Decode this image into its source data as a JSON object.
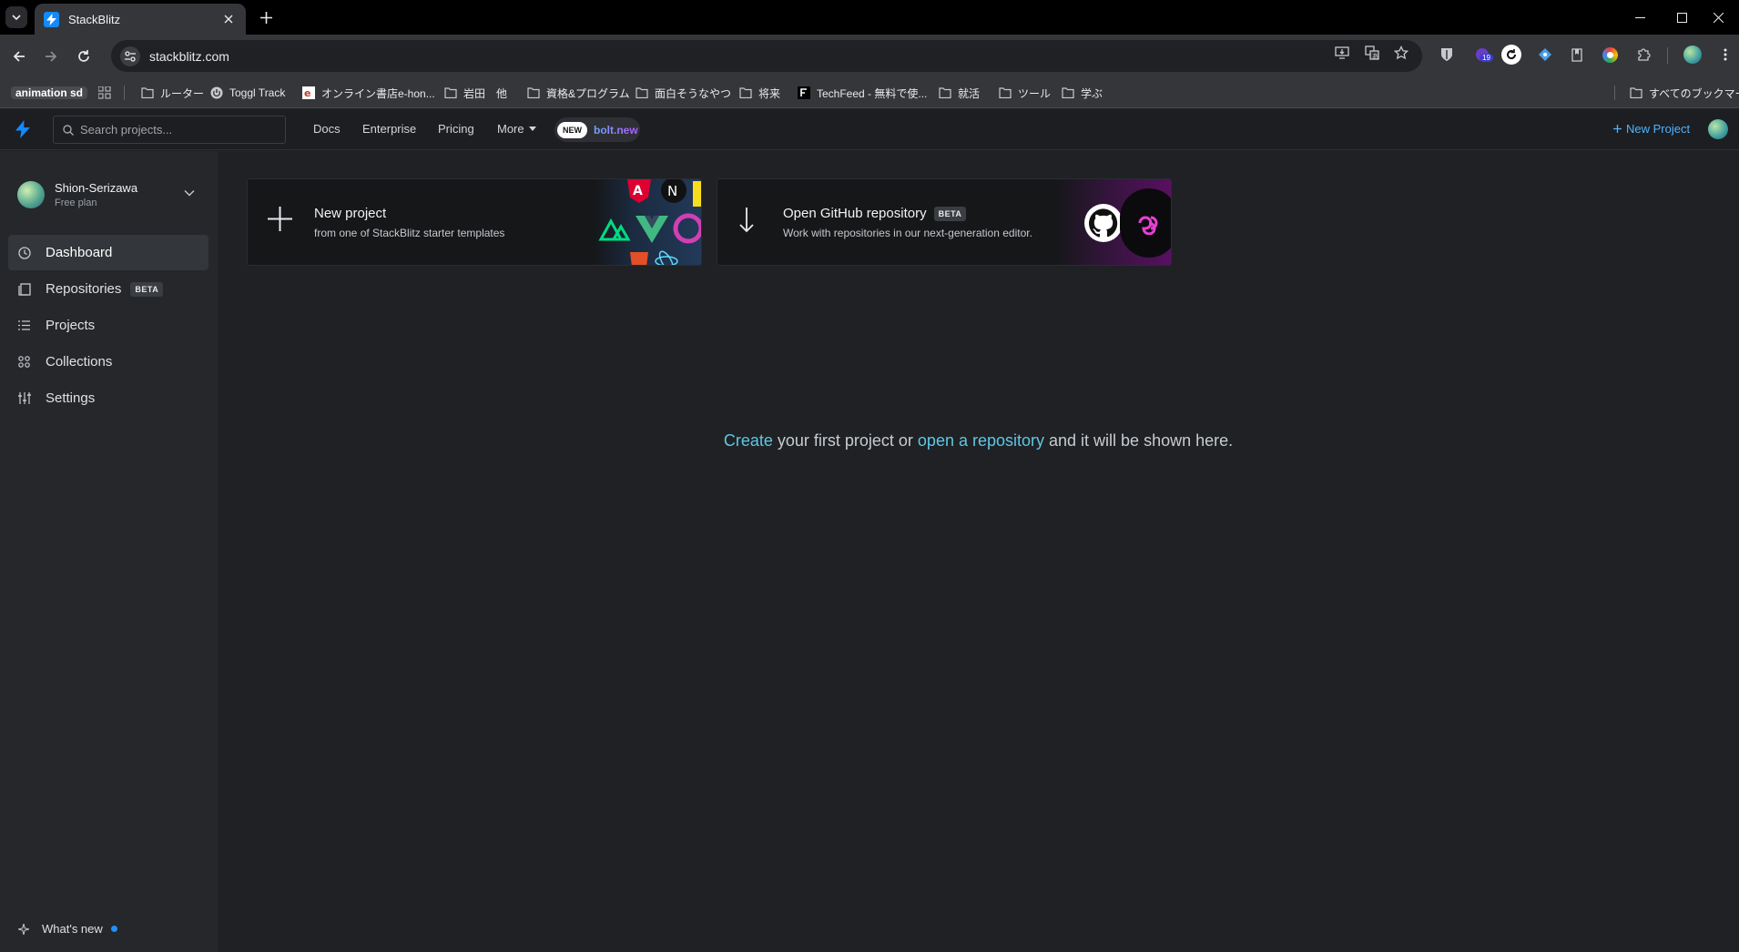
{
  "browser": {
    "tab_title": "StackBlitz",
    "url": "stackblitz.com",
    "extension_badge": "19",
    "bookmarks": [
      {
        "label": "animation sd",
        "type": "pill"
      },
      {
        "label": "",
        "type": "apps-icon"
      },
      {
        "label": "ルーター",
        "type": "folder"
      },
      {
        "label": "Toggl Track",
        "type": "site"
      },
      {
        "label": "オンライン書店e-hon...",
        "type": "site"
      },
      {
        "label": "岩田　他",
        "type": "folder"
      },
      {
        "label": "資格&プログラム",
        "type": "folder"
      },
      {
        "label": "面白そうなやつ",
        "type": "folder"
      },
      {
        "label": "将来",
        "type": "folder"
      },
      {
        "label": "TechFeed - 無料で使...",
        "type": "site"
      },
      {
        "label": "就活",
        "type": "folder"
      },
      {
        "label": "ツール",
        "type": "folder"
      },
      {
        "label": "学ぶ",
        "type": "folder"
      }
    ],
    "all_bookmarks": "すべてのブックマーク"
  },
  "header": {
    "search_placeholder": "Search projects...",
    "nav": [
      "Docs",
      "Enterprise",
      "Pricing",
      "More"
    ],
    "new_badge": "NEW",
    "bolt_label": "bolt.new",
    "new_project": "New Project"
  },
  "sidebar": {
    "user_name": "Shion-Serizawa",
    "plan": "Free plan",
    "items": [
      {
        "label": "Dashboard",
        "icon": "clock-icon",
        "active": true
      },
      {
        "label": "Repositories",
        "icon": "repo-icon",
        "badge": "BETA"
      },
      {
        "label": "Projects",
        "icon": "list-icon"
      },
      {
        "label": "Collections",
        "icon": "grid-icon"
      },
      {
        "label": "Settings",
        "icon": "sliders-icon"
      }
    ],
    "whats_new": "What's new"
  },
  "cards": [
    {
      "title": "New project",
      "subtitle": "from one of StackBlitz starter templates",
      "icon": "plus-icon"
    },
    {
      "title": "Open GitHub repository",
      "badge": "BETA",
      "subtitle": "Work with repositories in our next-generation editor.",
      "icon": "arrow-down-icon"
    }
  ],
  "empty_state": {
    "link1": "Create",
    "text1": " your first project or ",
    "link2": "open a repository",
    "text2": " and it will be shown here."
  },
  "colors": {
    "accent": "#1389fd",
    "link": "#5ec8e5",
    "background": "#1f2124"
  }
}
